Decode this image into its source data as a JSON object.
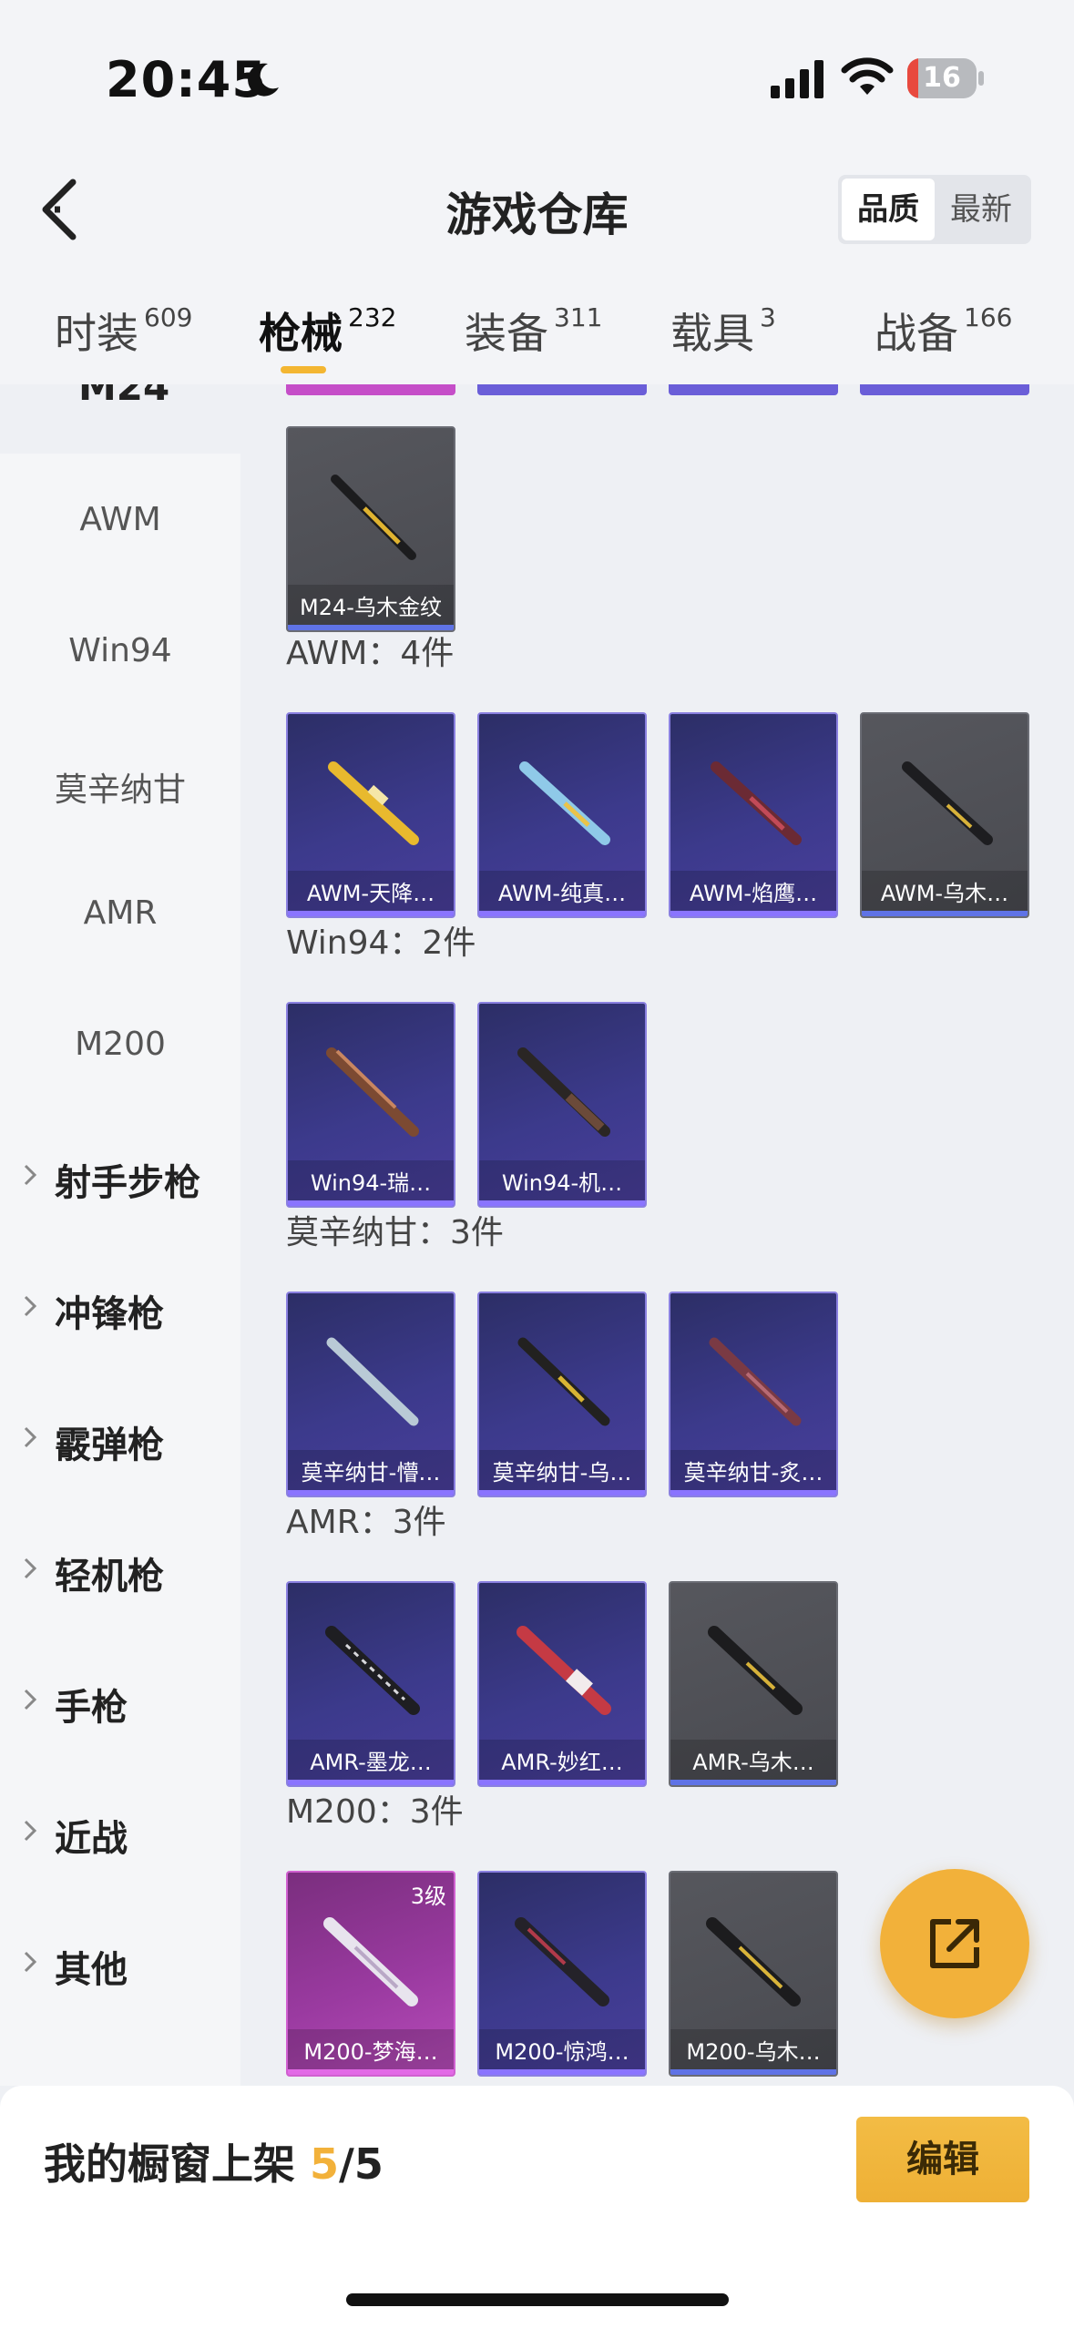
{
  "status_bar": {
    "time": "20:45",
    "battery_level": "16",
    "battery_fraction": 0.16,
    "moon_icon": "moon-icon",
    "signal_icon": "cellular-signal-icon",
    "wifi_icon": "wifi-icon"
  },
  "header": {
    "title": "游戏仓库",
    "sort_options": [
      "品质",
      "最新"
    ],
    "sort_selected": "品质"
  },
  "tabs": [
    {
      "label": "时装",
      "count": "609"
    },
    {
      "label": "枪械",
      "count": "232"
    },
    {
      "label": "装备",
      "count": "311"
    },
    {
      "label": "载具",
      "count": "3"
    },
    {
      "label": "战备",
      "count": "166"
    }
  ],
  "active_tab": "枪械",
  "sidebar": {
    "current_partial": "M24",
    "items": [
      "AWM",
      "Win94",
      "莫辛纳甘",
      "AMR",
      "M200"
    ],
    "groups": [
      "射手步枪",
      "冲锋枪",
      "霰弹枪",
      "轻机枪",
      "手枪",
      "近战",
      "其他"
    ]
  },
  "sections": [
    {
      "title": "",
      "items": [
        {
          "name": "M24-乌木金纹",
          "rarity": "gray"
        }
      ]
    },
    {
      "title": "AWM：4件",
      "items": [
        {
          "name": "AWM-天降…",
          "rarity": "purple"
        },
        {
          "name": "AWM-纯真…",
          "rarity": "purple"
        },
        {
          "name": "AWM-焰鹰…",
          "rarity": "purple"
        },
        {
          "name": "AWM-乌木…",
          "rarity": "gray"
        }
      ]
    },
    {
      "title": "Win94：2件",
      "items": [
        {
          "name": "Win94-瑞…",
          "rarity": "purple"
        },
        {
          "name": "Win94-机…",
          "rarity": "purple"
        }
      ]
    },
    {
      "title": "莫辛纳甘：3件",
      "items": [
        {
          "name": "莫辛纳甘-懵…",
          "rarity": "purple"
        },
        {
          "name": "莫辛纳甘-乌…",
          "rarity": "purple"
        },
        {
          "name": "莫辛纳甘-炙…",
          "rarity": "purple"
        }
      ]
    },
    {
      "title": "AMR：3件",
      "items": [
        {
          "name": "AMR-墨龙…",
          "rarity": "purple"
        },
        {
          "name": "AMR-妙红…",
          "rarity": "purple"
        },
        {
          "name": "AMR-乌木…",
          "rarity": "gray"
        }
      ]
    },
    {
      "title": "M200：3件",
      "items": [
        {
          "name": "M200-梦海…",
          "rarity": "pink",
          "level": "3级"
        },
        {
          "name": "M200-惊鸿…",
          "rarity": "purple"
        },
        {
          "name": "M200-乌木…",
          "rarity": "gray"
        }
      ]
    }
  ],
  "share_icon": "share-icon",
  "bottom": {
    "showcase_label": "我的橱窗上架",
    "showcase_current": "5",
    "showcase_total": "/5",
    "edit_label": "编辑"
  },
  "colors": {
    "accent": "#f2b13a",
    "purple_card": "#3c3a8c",
    "gray_card": "#505157",
    "pink_card": "#9a3aa0"
  }
}
